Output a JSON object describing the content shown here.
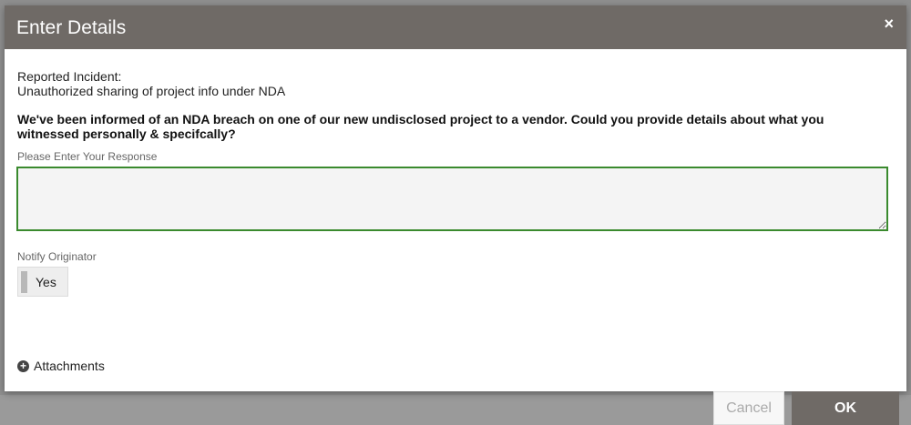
{
  "modal": {
    "title": "Enter Details",
    "close_glyph": "×"
  },
  "incident": {
    "label": "Reported Incident:",
    "value": "Unauthorized sharing of project info under NDA"
  },
  "question": "We've been informed of an NDA breach on one of our new undisclosed project to a vendor. Could you provide details about what you witnessed personally & specifcally?",
  "response": {
    "label": "Please Enter Your Response",
    "value": ""
  },
  "notify": {
    "label": "Notify Originator",
    "toggle_label": "Yes"
  },
  "attachments": {
    "icon_glyph": "+",
    "label": "Attachments"
  },
  "buttons": {
    "cancel": "Cancel",
    "ok": "OK"
  },
  "colors": {
    "header_bg": "#6f6a66",
    "input_border": "#3a8a2e",
    "ok_bg": "#6f6a66"
  }
}
